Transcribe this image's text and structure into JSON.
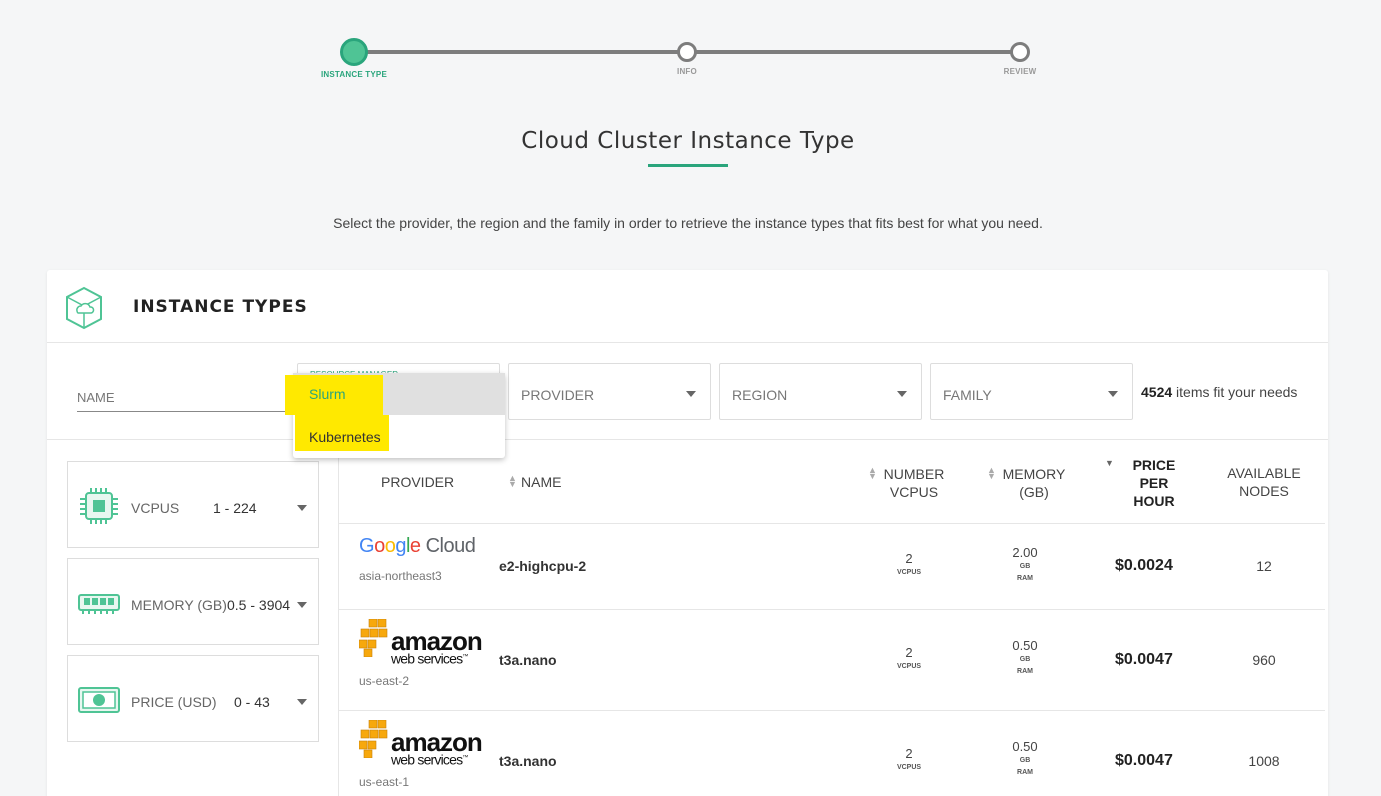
{
  "stepper": {
    "steps": [
      {
        "label": "INSTANCE TYPE"
      },
      {
        "label": "INFO"
      },
      {
        "label": "REVIEW"
      }
    ],
    "active_color": "#2aa57c"
  },
  "page": {
    "title": "Cloud Cluster Instance Type",
    "subtitle": "Select the provider, the region and the family in order to retrieve the instance types that fits best for what you need."
  },
  "card": {
    "title": "INSTANCE TYPES"
  },
  "filters": {
    "name_placeholder": "NAME",
    "resource_manager_label": "RESOURCE MANAGER",
    "provider": "PROVIDER",
    "region": "REGION",
    "family": "FAMILY",
    "count": "4524",
    "count_suffix": " items fit your needs"
  },
  "dropdown": {
    "options": [
      "Slurm",
      "Kubernetes"
    ],
    "highlight_color": "#ffe900"
  },
  "side_filters": [
    {
      "label": "VCPUS",
      "range": "1 - 224",
      "icon": "cpu-icon"
    },
    {
      "label": "MEMORY (GB)",
      "range": "0.5 - 3904",
      "icon": "memory-icon"
    },
    {
      "label": "PRICE (USD)",
      "range": "0 - 43",
      "icon": "money-icon"
    }
  ],
  "table": {
    "headers": {
      "provider": "PROVIDER",
      "name": "NAME",
      "vcpus_1": "NUMBER",
      "vcpus_2": "VCPUS",
      "mem_1": "MEMORY",
      "mem_2": "(GB)",
      "price_1": "PRICE",
      "price_2": "PER",
      "price_3": "HOUR",
      "nodes_1": "AVAILABLE",
      "nodes_2": "NODES"
    },
    "rows": [
      {
        "provider_logo": "Google Cloud",
        "region": "asia-northeast3",
        "name": "e2-highcpu-2",
        "vcpus": "2",
        "vcpus_unit": "VCPUS",
        "memory": "2.00",
        "mem_unit_1": "GB",
        "mem_unit_2": "RAM",
        "price": "$0.0024",
        "nodes": "12"
      },
      {
        "provider_logo": "amazon web services",
        "region": "us-east-2",
        "name": "t3a.nano",
        "vcpus": "2",
        "vcpus_unit": "VCPUS",
        "memory": "0.50",
        "mem_unit_1": "GB",
        "mem_unit_2": "RAM",
        "price": "$0.0047",
        "nodes": "960"
      },
      {
        "provider_logo": "amazon web services",
        "region": "us-east-1",
        "name": "t3a.nano",
        "vcpus": "2",
        "vcpus_unit": "VCPUS",
        "memory": "0.50",
        "mem_unit_1": "GB",
        "mem_unit_2": "RAM",
        "price": "$0.0047",
        "nodes": "1008"
      }
    ]
  },
  "logos": {
    "google": {
      "word": "Google",
      "suffix": "Cloud"
    },
    "aws": {
      "word": "amazon",
      "sub": "web services",
      "tm": "™"
    }
  }
}
